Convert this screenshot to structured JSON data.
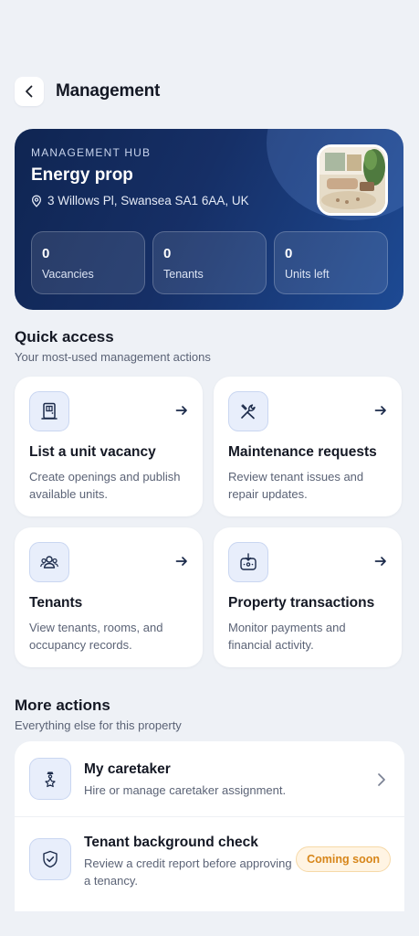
{
  "header": {
    "title": "Management"
  },
  "hub": {
    "kicker": "MANAGEMENT HUB",
    "property_name": "Energy prop",
    "address": "3 Willows Pl, Swansea SA1 6AA, UK",
    "stats": [
      {
        "value": "0",
        "label": "Vacancies"
      },
      {
        "value": "0",
        "label": "Tenants"
      },
      {
        "value": "0",
        "label": "Units left"
      }
    ]
  },
  "quick_access": {
    "title": "Quick access",
    "subtitle": "Your most-used management actions",
    "cards": [
      {
        "icon": "door-icon",
        "title": "List a unit vacancy",
        "description": "Create openings and publish available units."
      },
      {
        "icon": "tools-icon",
        "title": "Maintenance requests",
        "description": "Review tenant issues and repair updates."
      },
      {
        "icon": "users-icon",
        "title": "Tenants",
        "description": "View tenants, rooms, and occupancy records."
      },
      {
        "icon": "wallet-icon",
        "title": "Property transactions",
        "description": "Monitor payments and financial activity."
      }
    ]
  },
  "more_actions": {
    "title": "More actions",
    "subtitle": "Everything else for this property",
    "items": [
      {
        "icon": "caretaker-icon",
        "title": "My caretaker",
        "description": "Hire or manage caretaker assignment."
      },
      {
        "icon": "shield-check-icon",
        "title": "Tenant background check",
        "description": "Review a credit report before approving a tenancy.",
        "badge": "Coming soon"
      }
    ]
  },
  "colors": {
    "accent": "#1d4a94",
    "badge": "#d7861a",
    "background": "#eef1f6"
  }
}
